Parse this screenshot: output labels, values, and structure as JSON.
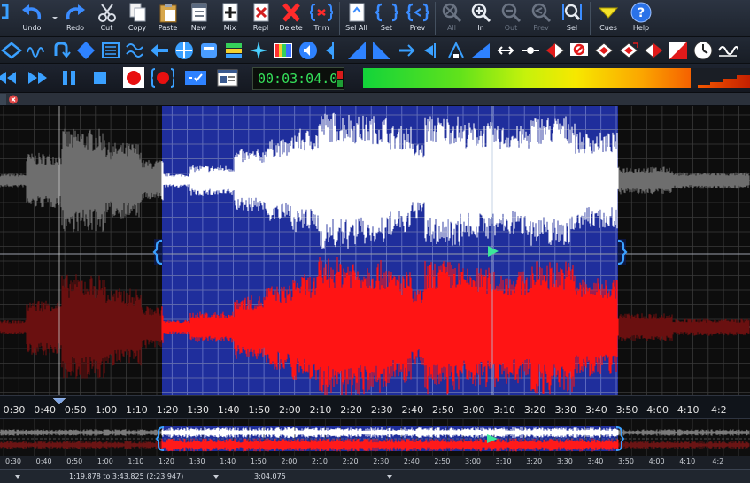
{
  "toolbar": {
    "buttons": [
      {
        "key": "undo",
        "label": "Undo"
      },
      {
        "key": "redo",
        "label": "Redo"
      },
      {
        "key": "cut",
        "label": "Cut"
      },
      {
        "key": "copy",
        "label": "Copy"
      },
      {
        "key": "paste",
        "label": "Paste"
      },
      {
        "key": "new",
        "label": "New"
      },
      {
        "key": "mix",
        "label": "Mix"
      },
      {
        "key": "repl",
        "label": "Repl"
      },
      {
        "key": "delete",
        "label": "Delete"
      },
      {
        "key": "trim",
        "label": "Trim"
      },
      {
        "key": "selall",
        "label": "Sel All"
      },
      {
        "key": "set",
        "label": "Set"
      },
      {
        "key": "prev",
        "label": "Prev"
      },
      {
        "key": "zoom_all",
        "label": "All"
      },
      {
        "key": "zoom_in",
        "label": "In"
      },
      {
        "key": "zoom_out",
        "label": "Out"
      },
      {
        "key": "zoom_prev",
        "label": "Prev"
      },
      {
        "key": "zoom_sel",
        "label": "Sel"
      },
      {
        "key": "cues",
        "label": "Cues"
      },
      {
        "key": "help",
        "label": "Help"
      }
    ]
  },
  "transport": {
    "time_display": "00:03:04.0"
  },
  "ruler": {
    "labels": [
      "0:30",
      "0:40",
      "0:50",
      "1:00",
      "1:10",
      "1:20",
      "1:30",
      "1:40",
      "1:50",
      "2:00",
      "2:10",
      "2:20",
      "2:30",
      "2:40",
      "2:50",
      "3:00",
      "3:10",
      "3:20",
      "3:30",
      "3:40",
      "3:50",
      "4:00",
      "4:10",
      "4:2"
    ]
  },
  "overview": {
    "labels": [
      "0:30",
      "0:40",
      "0:50",
      "1:00",
      "1:10",
      "1:20",
      "1:30",
      "1:40",
      "1:50",
      "2:00",
      "2:10",
      "2:20",
      "2:30",
      "2:40",
      "2:50",
      "3:00",
      "3:10",
      "3:20",
      "3:30",
      "3:40",
      "3:50",
      "4:00",
      "4:10",
      "4:2"
    ]
  },
  "status": {
    "selection": "1:19.878 to 3:43.825 (2:23.947)",
    "cursor": "3:04.075"
  },
  "colors": {
    "selection": "#1f2e9c",
    "left_channel": "#ffffff",
    "right_channel": "#ff1414",
    "time_text": "#35e05a"
  }
}
